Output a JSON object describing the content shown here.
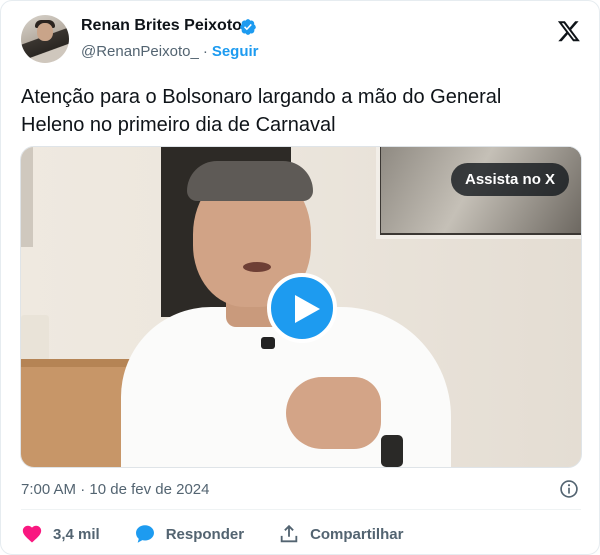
{
  "author": {
    "name": "Renan Brites Peixoto",
    "handle": "@RenanPeixoto_",
    "separator": "·",
    "follow_label": "Seguir",
    "verified": true
  },
  "platform_icon": "x-logo-icon",
  "tweet": {
    "text": "Atenção para o Bolsonaro largando a mão do General Heleno no primeiro dia de Carnaval"
  },
  "media": {
    "type": "video",
    "watch_label": "Assista no X",
    "play_icon": "play-icon"
  },
  "meta": {
    "time": "7:00 AM",
    "separator": "·",
    "date": "10 de fev de 2024",
    "info_icon": "info-icon"
  },
  "actions": {
    "like": {
      "icon": "heart-icon",
      "count": "3,4 mil",
      "color": "#f91880"
    },
    "reply": {
      "icon": "speech-bubble-icon",
      "label": "Responder",
      "color": "#1d9bf0"
    },
    "share": {
      "icon": "share-upload-icon",
      "label": "Compartilhar"
    }
  },
  "colors": {
    "accent": "#1d9bf0",
    "text_primary": "#0f1419",
    "text_secondary": "#536471"
  }
}
